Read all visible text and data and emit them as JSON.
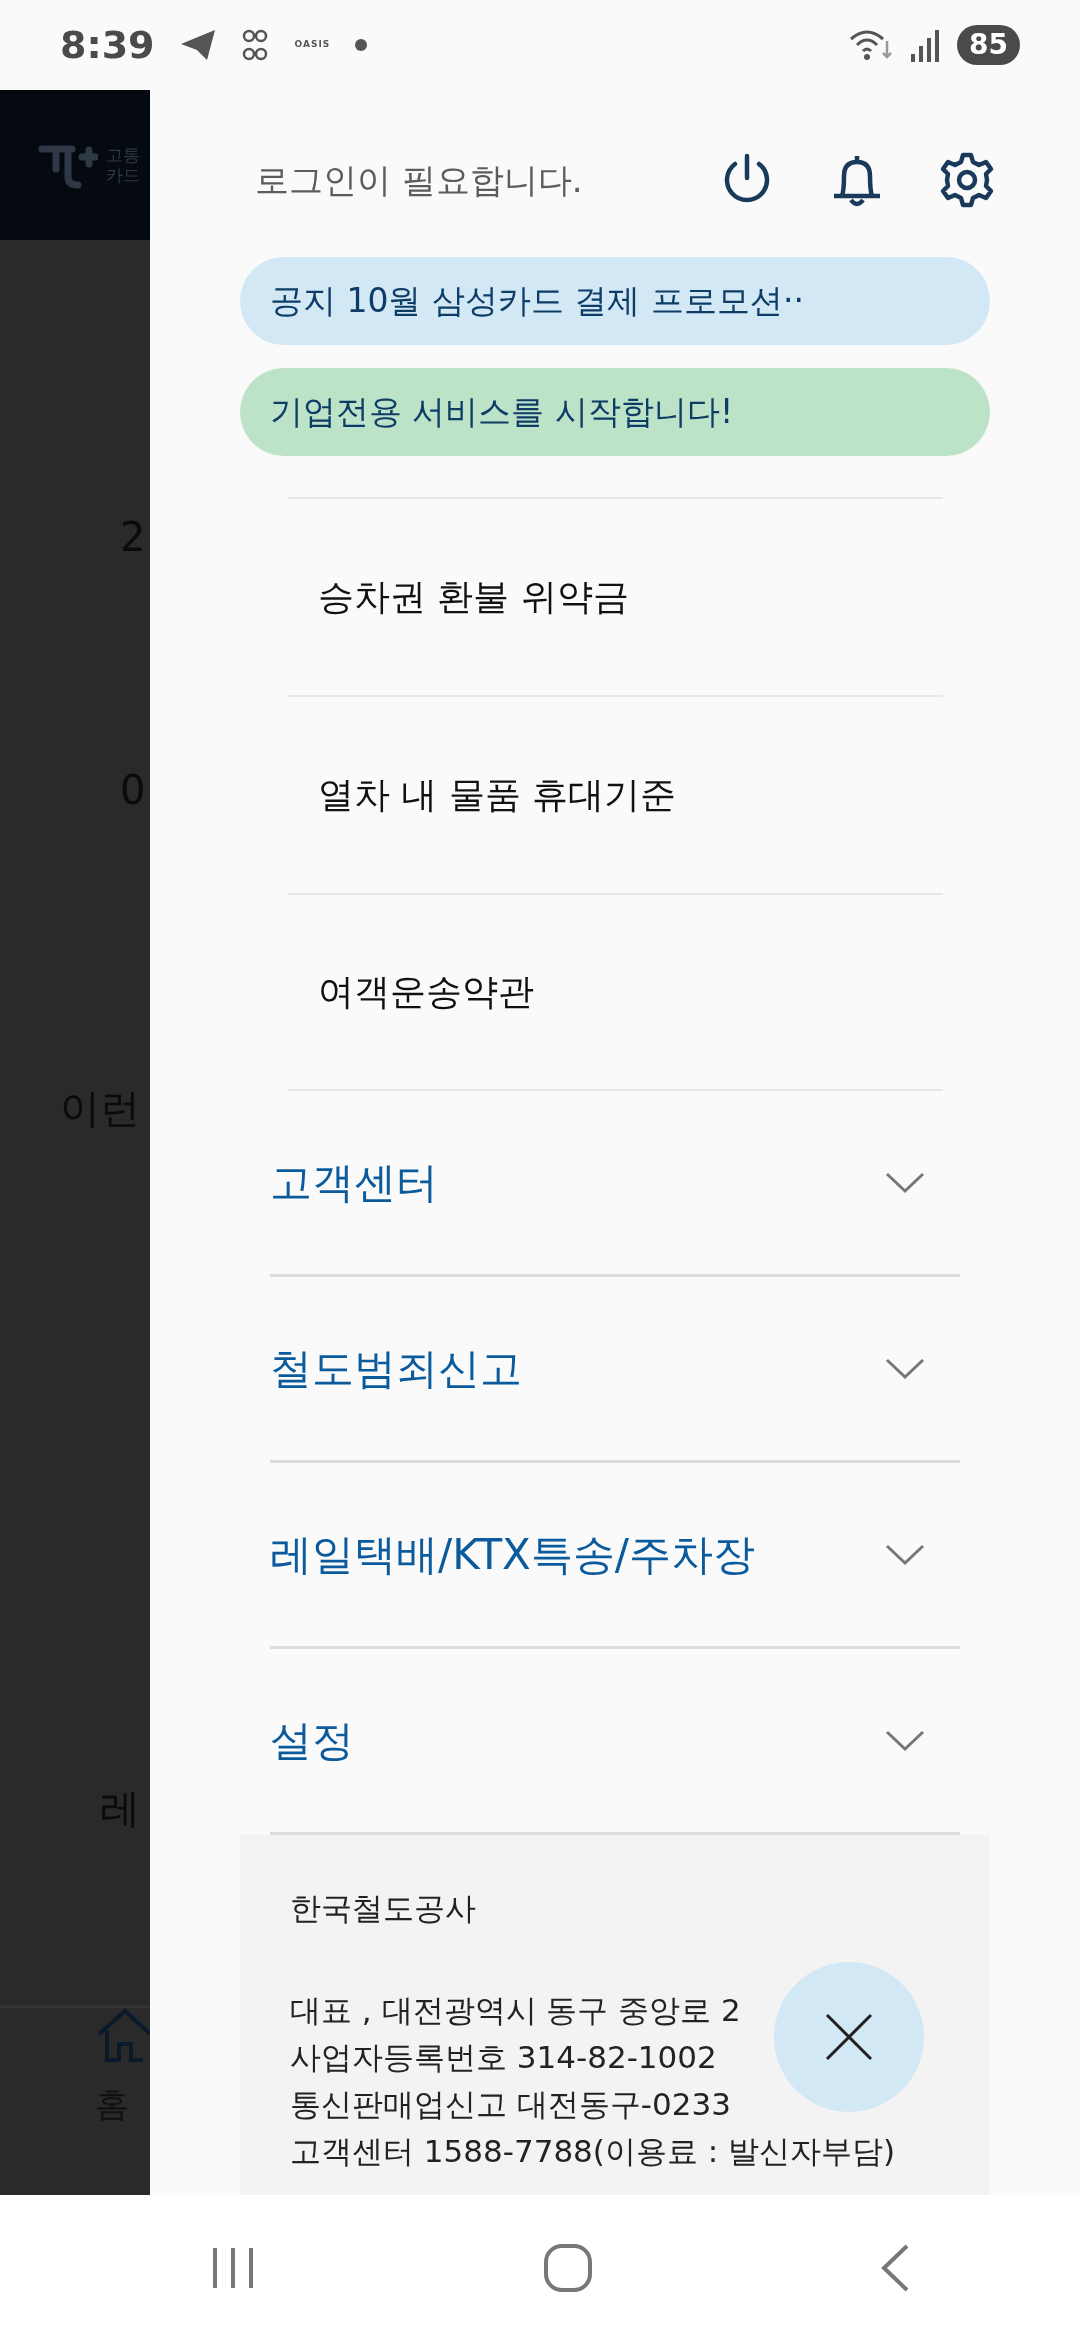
{
  "status_bar": {
    "time": "8:39",
    "app_label": "OASIS",
    "battery": "85"
  },
  "background_app": {
    "logo_lines": [
      "고통",
      "카드"
    ],
    "fragments": [
      {
        "kind": "value",
        "text": "2"
      },
      {
        "kind": "value",
        "text": "0"
      },
      {
        "kind": "heading",
        "text": "이런"
      },
      {
        "kind": "card_text",
        "text": "레"
      }
    ],
    "nav_label": "홈"
  },
  "drawer": {
    "login_message": "로그인이 필요합니다.",
    "notices": [
      {
        "text": "공지  10월 삼성카드 결제 프로모션··",
        "color": "#d2e8f5"
      },
      {
        "text": "기업전용 서비스를 시작합니다!",
        "color": "#bce2c8"
      }
    ],
    "sub_items": [
      "승차권 환불 위약금",
      "열차 내 물품 휴대기준",
      "여객운송약관"
    ],
    "sections": [
      {
        "label": "고객센터",
        "expanded": false
      },
      {
        "label": "철도범죄신고",
        "expanded": false
      },
      {
        "label": "레일택배/KTX특송/주차장",
        "expanded": false
      },
      {
        "label": "설정",
        "expanded": false
      }
    ],
    "footer": {
      "company": "한국철도공사",
      "lines": [
        "대표 , 대전광역시 동구 중앙로 2",
        "사업자등록번호 314-82-1002",
        "통신판매업신고 대전동구-0233",
        "고객센터 1588-7788(이용료 : 발신자부담)"
      ]
    }
  }
}
